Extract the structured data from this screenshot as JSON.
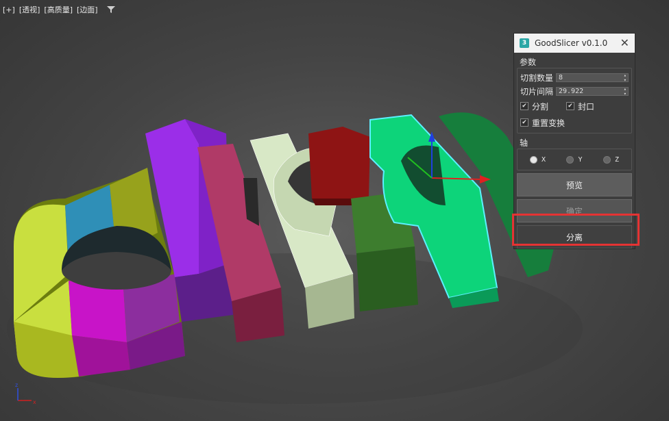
{
  "viewport": {
    "labels": [
      "[+]",
      "[透视]",
      "[高质量]",
      "[边面]"
    ],
    "filter_icon": "filter-icon"
  },
  "dialog": {
    "title": "GoodSlicer v0.1.0",
    "app_icon": "3",
    "close_glyph": "✕",
    "params_group": "参数",
    "slice_count_label": "切割数量",
    "slice_count_value": "8",
    "slice_spacing_label": "切片间隔",
    "slice_spacing_value": "29.922",
    "split_label": "分割",
    "cap_label": "封口",
    "reset_label": "重置变换",
    "split_checked": true,
    "cap_checked": true,
    "reset_checked": true,
    "axis_group": "轴",
    "axis_options": [
      "X",
      "Y",
      "Z"
    ],
    "axis_selected": "X",
    "preview_button": "预览",
    "confirm_button": "确定",
    "detach_button": "分离"
  },
  "colors": {
    "highlight": "#e53333",
    "selection": "#5cf0ff"
  }
}
